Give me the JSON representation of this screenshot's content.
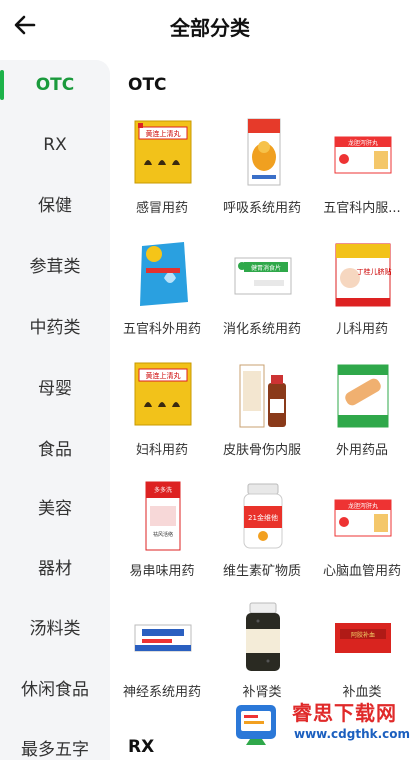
{
  "header": {
    "title": "全部分类"
  },
  "sidebar": {
    "items": [
      {
        "label": "OTC",
        "active": true
      },
      {
        "label": "RX"
      },
      {
        "label": "保健"
      },
      {
        "label": "参茸类"
      },
      {
        "label": "中药类"
      },
      {
        "label": "母婴"
      },
      {
        "label": "食品"
      },
      {
        "label": "美容"
      },
      {
        "label": "器材"
      },
      {
        "label": "汤料类"
      },
      {
        "label": "休闲食品"
      },
      {
        "label": "最多五字"
      }
    ]
  },
  "sections": [
    {
      "title": "OTC",
      "items": [
        {
          "label": "感冒用药"
        },
        {
          "label": "呼吸系统用药"
        },
        {
          "label": "五官科内服..."
        },
        {
          "label": "五官科外用药"
        },
        {
          "label": "消化系统用药"
        },
        {
          "label": "儿科用药"
        },
        {
          "label": "妇科用药"
        },
        {
          "label": "皮肤骨伤内服"
        },
        {
          "label": "外用药品"
        },
        {
          "label": "易串味用药"
        },
        {
          "label": "维生素矿物质"
        },
        {
          "label": "心脑血管用药"
        },
        {
          "label": "神经系统用药"
        },
        {
          "label": "补肾类"
        },
        {
          "label": "补血类"
        }
      ]
    },
    {
      "title": "RX",
      "items": []
    }
  ],
  "watermark": {
    "name": "睿思下载网",
    "url": "www.cdgthk.com"
  },
  "colors": {
    "accent": "#1a9a3c",
    "sidebar_bg": "#f4f5f7"
  }
}
